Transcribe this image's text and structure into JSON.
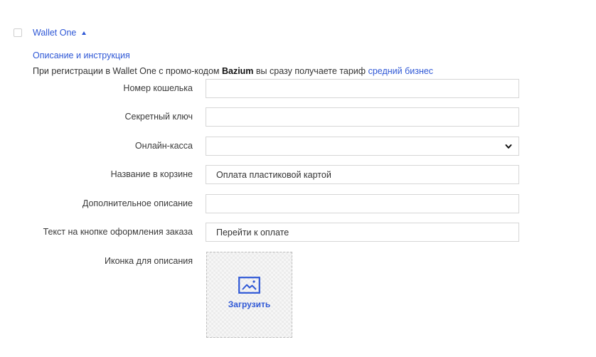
{
  "provider": {
    "title": "Wallet One",
    "description_link": "Описание и инструкция",
    "promo": {
      "before": "При регистрации в Wallet One с промо-кодом ",
      "code": "Bazium",
      "middle": " вы сразу получаете тариф ",
      "tariff_link": "средний бизнес"
    }
  },
  "form": {
    "wallet_number": {
      "label": "Номер кошелька",
      "value": ""
    },
    "secret_key": {
      "label": "Секретный ключ",
      "value": ""
    },
    "online_cashbox": {
      "label": "Онлайн-касса",
      "value": ""
    },
    "cart_name": {
      "label": "Название в корзине",
      "value": "Оплата пластиковой картой"
    },
    "extra_description": {
      "label": "Дополнительное описание",
      "value": ""
    },
    "checkout_button_text": {
      "label": "Текст на кнопке оформления заказа",
      "value": "Перейти к оплате"
    },
    "icon": {
      "label": "Иконка для описания",
      "upload_label": "Загрузить"
    }
  },
  "colors": {
    "accent": "#2f58d6",
    "border": "#d6d6d6"
  }
}
